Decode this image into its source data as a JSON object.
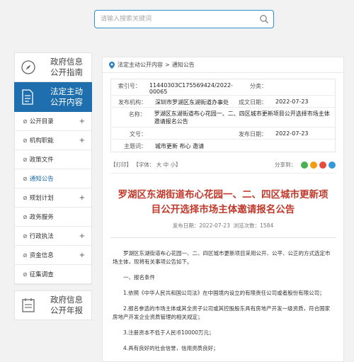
{
  "search": {
    "placeholder": "请输入搜索关键词"
  },
  "nav": {
    "guide_label_1": "政府信息",
    "guide_label_2": "公开指南",
    "main_label_1": "法定主动",
    "main_label_2": "公开内容",
    "items": [
      {
        "label": "公开目录",
        "plus": "+"
      },
      {
        "label": "机构职能",
        "plus": "+"
      },
      {
        "label": "政策文件",
        "plus": ""
      },
      {
        "label": "通知公告",
        "plus": ""
      },
      {
        "label": "规划计划",
        "plus": "+"
      },
      {
        "label": "政务服务",
        "plus": ""
      },
      {
        "label": "行政执法",
        "plus": "+"
      },
      {
        "label": "资金信息",
        "plus": "+"
      },
      {
        "label": "征集调查",
        "plus": ""
      }
    ],
    "annual_label_1": "政府信息",
    "annual_label_2": "公开年报"
  },
  "breadcrumb": {
    "first": "法定主动公开内容",
    "sep": ">",
    "second": "通知公告"
  },
  "meta": {
    "index_key": "索引号：",
    "index_val": "11440303C175569424/2022-00065",
    "cat_key": "分类：",
    "cat_val": "",
    "org_key": "发布机构：",
    "org_val": "深圳市罗湖区东湖街道办事处",
    "date_key": "成文日期：",
    "date_val": "2022-07-23",
    "name_key": "名称：",
    "name_val": "罗湖区东湖街道布心花园一、二、四区城市更新项目公开选择市场主体邀请报名公告",
    "doc_key": "文号：",
    "doc_val": "",
    "pub_key": "发布日期：",
    "pub_val": "2022-07-23",
    "topic_key": "主题词：",
    "topic_val": "城市更新 布心 邀请"
  },
  "tools": {
    "print": "【打印】",
    "font": "【字体：",
    "big": "大",
    "mid": "中",
    "small": "小】",
    "share": "分享到："
  },
  "article": {
    "title": "罗湖区东湖街道布心花园一、二、四区城市更新项目公开选择市场主体邀请报名公告",
    "date_label": "发布日期：2022-07-23",
    "views_label": "浏览次数：1584",
    "p1": "罗湖区东湖街道布心花园一、二、四区城市更新项目采用公开、公平、公正的方式选定市场主体，现将有关事项公告如下。",
    "h1": "一、报名条件",
    "p2": "1.依照《中华人民共和国公司法》在中国境内设立的有限责任公司或者股份有限公司；",
    "p3": "2.报名参选的市场主体或其全资子公司或其控股股东具有房地产开发一级资质，符合国家房地产开发企业资质管理的相关规定；",
    "p4": "3.注册资本不低于人民币10000万元；",
    "p5": "4.具有良好的社会信誉，信用资质良好；"
  },
  "colors": {
    "accent": "#1f6fae",
    "title_red": "#c0392b",
    "share_green": "#4caf50",
    "share_orange": "#f39c12",
    "share_red": "#e74c3c",
    "share_blue": "#3498db"
  }
}
